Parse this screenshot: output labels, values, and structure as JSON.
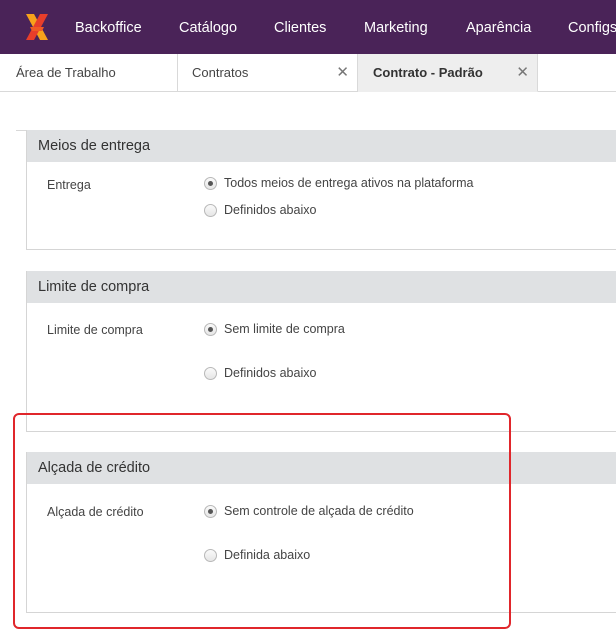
{
  "nav": {
    "items": [
      "Backoffice",
      "Catálogo",
      "Clientes",
      "Marketing",
      "Aparência",
      "Configs"
    ],
    "background": "#4a2358",
    "logo_colors": [
      "#f7a21b",
      "#e83e2a"
    ]
  },
  "tabs": [
    {
      "label": "Área de Trabalho",
      "closable": false,
      "active": false
    },
    {
      "label": "Contratos",
      "closable": true,
      "active": false
    },
    {
      "label": "Contrato - Padrão",
      "closable": true,
      "active": true
    }
  ],
  "sections": [
    {
      "title": "Meios de entrega",
      "field_label": "Entrega",
      "options": [
        {
          "label": "Todos meios de entrega ativos na plataforma",
          "selected": true
        },
        {
          "label": "Definidos abaixo",
          "selected": false
        }
      ]
    },
    {
      "title": "Limite de compra",
      "field_label": "Limite de compra",
      "options": [
        {
          "label": "Sem limite de compra",
          "selected": true
        },
        {
          "label": "Definidos abaixo",
          "selected": false
        }
      ]
    },
    {
      "title": "Alçada de crédito",
      "field_label": "Alçada de crédito",
      "options": [
        {
          "label": "Sem controle de alçada de crédito",
          "selected": true
        },
        {
          "label": "Definida abaixo",
          "selected": false
        }
      ]
    }
  ],
  "highlight_color": "#e0262b"
}
